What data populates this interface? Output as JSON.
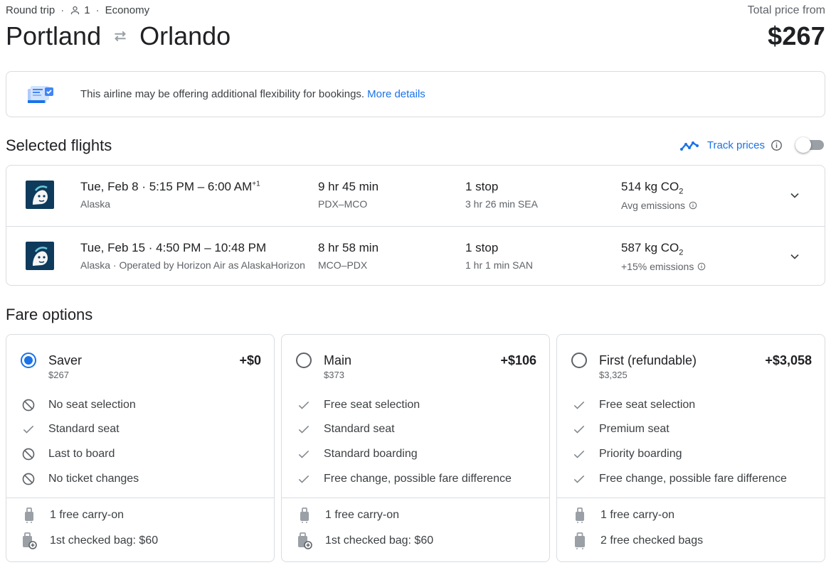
{
  "header": {
    "trip_type": "Round trip",
    "passengers": "1",
    "cabin": "Economy",
    "origin": "Portland",
    "destination": "Orlando",
    "price_label": "Total price from",
    "price": "$267"
  },
  "banner": {
    "text": "This airline may be offering additional flexibility for bookings.",
    "link": "More details"
  },
  "selected_flights": {
    "title": "Selected flights",
    "track_label": "Track prices",
    "track_enabled": false,
    "flights": [
      {
        "date": "Tue, Feb 8",
        "time_range": "5:15 PM – 6:00 AM",
        "day_offset": "+1",
        "airline": "Alaska",
        "duration": "9 hr 45 min",
        "route": "PDX–MCO",
        "stops": "1 stop",
        "layover": "3 hr 26 min SEA",
        "co2": "514 kg CO",
        "co2_sub": "2",
        "emissions": "Avg emissions"
      },
      {
        "date": "Tue, Feb 15",
        "time_range": "4:50 PM – 10:48 PM",
        "day_offset": "",
        "airline": "Alaska · Operated by Horizon Air as AlaskaHorizon",
        "duration": "8 hr 58 min",
        "route": "MCO–PDX",
        "stops": "1 stop",
        "layover": "1 hr 1 min SAN",
        "co2": "587 kg CO",
        "co2_sub": "2",
        "emissions": "+15% emissions"
      }
    ]
  },
  "fare_options": {
    "title": "Fare options",
    "fares": [
      {
        "name": "Saver",
        "price": "$267",
        "delta": "+$0",
        "selected": true,
        "features": [
          {
            "icon": "no-icon",
            "text": "No seat selection"
          },
          {
            "icon": "check-icon",
            "text": "Standard seat"
          },
          {
            "icon": "no-icon",
            "text": "Last to board"
          },
          {
            "icon": "no-icon",
            "text": "No ticket changes"
          }
        ],
        "bags": [
          {
            "icon": "carry-on-icon",
            "text": "1 free carry-on"
          },
          {
            "icon": "checked-bag-fee-icon",
            "text": "1st checked bag: $60"
          }
        ]
      },
      {
        "name": "Main",
        "price": "$373",
        "delta": "+$106",
        "selected": false,
        "features": [
          {
            "icon": "check-icon",
            "text": "Free seat selection"
          },
          {
            "icon": "check-icon",
            "text": "Standard seat"
          },
          {
            "icon": "check-icon",
            "text": "Standard boarding"
          },
          {
            "icon": "check-icon",
            "text": "Free change, possible fare difference"
          }
        ],
        "bags": [
          {
            "icon": "carry-on-icon",
            "text": "1 free carry-on"
          },
          {
            "icon": "checked-bag-fee-icon",
            "text": "1st checked bag: $60"
          }
        ]
      },
      {
        "name": "First (refundable)",
        "price": "$3,325",
        "delta": "+$3,058",
        "selected": false,
        "features": [
          {
            "icon": "check-icon",
            "text": "Free seat selection"
          },
          {
            "icon": "check-icon",
            "text": "Premium seat"
          },
          {
            "icon": "check-icon",
            "text": "Priority boarding"
          },
          {
            "icon": "check-icon",
            "text": "Free change, possible fare difference"
          }
        ],
        "bags": [
          {
            "icon": "carry-on-icon",
            "text": "1 free carry-on"
          },
          {
            "icon": "checked-bag-icon",
            "text": "2 free checked bags"
          }
        ]
      }
    ]
  },
  "colors": {
    "accent": "#1a73e8",
    "text": "#202124",
    "muted": "#5f6368",
    "border": "#dadce0",
    "alaska_logo": "#0e3b5c"
  }
}
